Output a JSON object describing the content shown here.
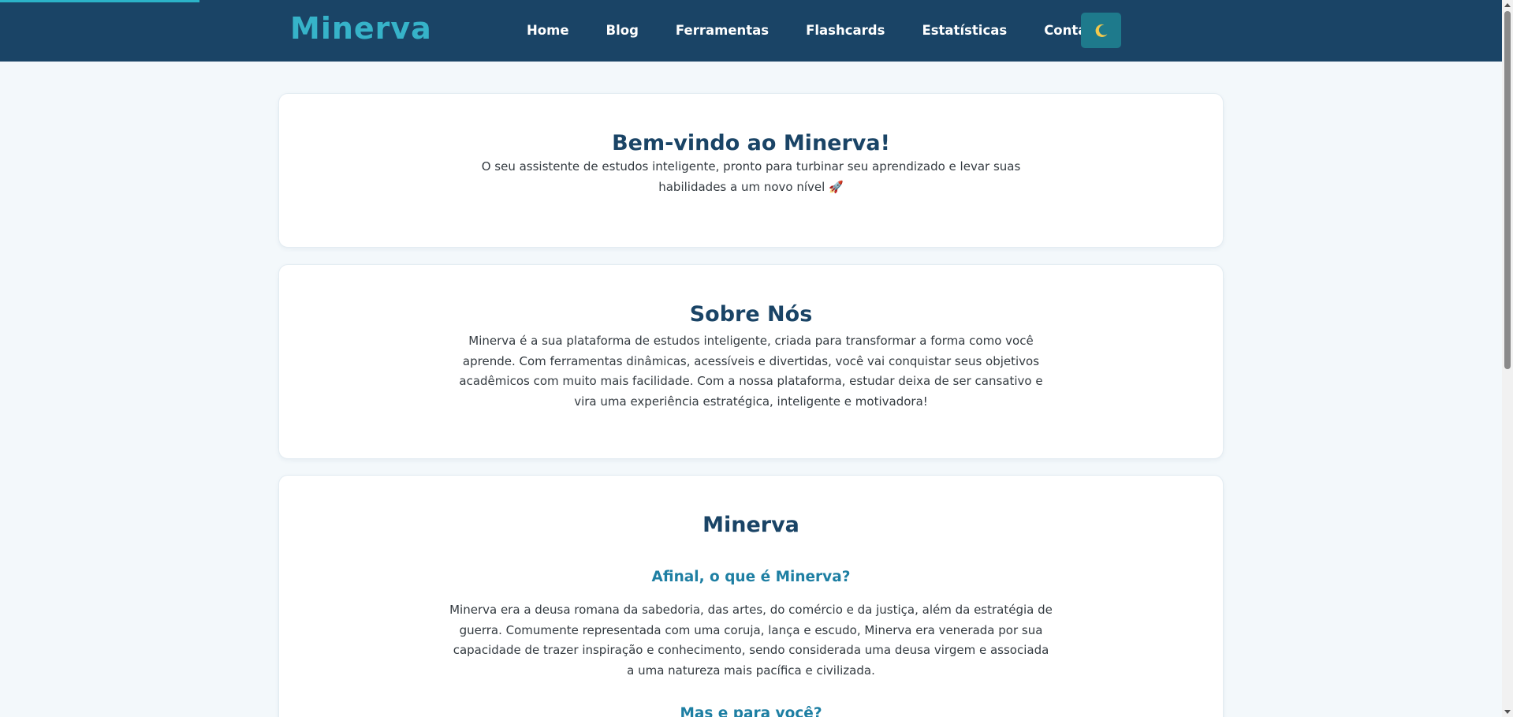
{
  "header": {
    "brand": "Minerva",
    "nav": [
      "Home",
      "Blog",
      "Ferramentas",
      "Flashcards",
      "Estatísticas",
      "Contatos"
    ],
    "theme_toggle_icon": "🌙"
  },
  "welcome": {
    "title": "Bem-vindo ao Minerva!",
    "text": "O seu assistente de estudos inteligente, pronto para turbinar seu aprendizado e levar suas habilidades a um novo nível 🚀"
  },
  "about": {
    "title": "Sobre Nós",
    "text": "Minerva é a sua plataforma de estudos inteligente, criada para transformar a forma como você aprende. Com ferramentas dinâmicas, acessíveis e divertidas, você vai conquistar seus objetivos acadêmicos com muito mais facilidade. Com a nossa plataforma, estudar deixa de ser cansativo e vira uma experiência estratégica, inteligente e motivadora!"
  },
  "minerva": {
    "title": "Minerva",
    "question1": "Afinal, o que é Minerva?",
    "answer1": "Minerva era a deusa romana da sabedoria, das artes, do comércio e da justiça, além da estratégia de guerra. Comumente representada com uma coruja, lança e escudo, Minerva era venerada por sua capacidade de trazer inspiração e conhecimento, sendo considerada uma deusa virgem e associada a uma natureza mais pacífica e civilizada.",
    "question2": "Mas e para você?"
  },
  "colors": {
    "header_bg": "#1a4466",
    "brand": "#36b3c9",
    "accent": "#1e7a8c",
    "heading": "#1a4466",
    "subheading": "#1e7fa3",
    "page_bg": "#f3f8fb"
  }
}
